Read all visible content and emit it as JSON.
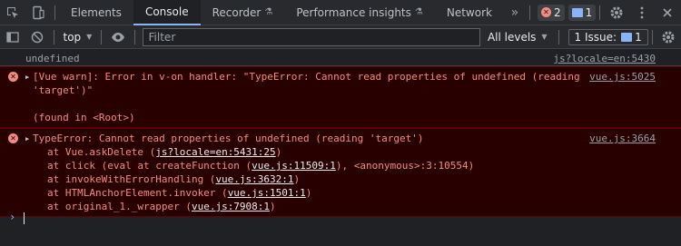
{
  "tabs": [
    {
      "label": "Elements"
    },
    {
      "label": "Console"
    },
    {
      "label": "Recorder"
    },
    {
      "label": "Performance insights"
    },
    {
      "label": "Network"
    }
  ],
  "tab_more": "»",
  "counts": {
    "errors": "2",
    "messages": "1"
  },
  "toolbar": {
    "context": "top",
    "filter_placeholder": "Filter",
    "levels": "All levels",
    "issues_label": "1 Issue:",
    "issues_count": "1"
  },
  "console": {
    "plain": {
      "text": "undefined",
      "source": "js?locale=en:5430"
    },
    "warn": {
      "line1": "[Vue warn]: Error in v-on handler: \"TypeError: Cannot read properties of undefined (reading 'target')\"",
      "line2": "(found in <Root>)",
      "source": "vue.js:5025"
    },
    "error": {
      "headline": "TypeError: Cannot read properties of undefined (reading 'target')",
      "source": "vue.js:3664",
      "frames": [
        {
          "prefix": "at Vue.askDelete (",
          "link": "js?locale=en:5431:25",
          "suffix": ")"
        },
        {
          "prefix": "at click (eval at createFunction (",
          "link": "vue.js:11509:1",
          "suffix": "), <anonymous>:3:10554)"
        },
        {
          "prefix": "at invokeWithErrorHandling (",
          "link": "vue.js:3632:1",
          "suffix": ")"
        },
        {
          "prefix": "at HTMLAnchorElement.invoker (",
          "link": "vue.js:1501:1",
          "suffix": ")"
        },
        {
          "prefix": "at original_1._wrapper (",
          "link": "vue.js:7908:1",
          "suffix": ")"
        }
      ]
    }
  },
  "colors": {
    "accent": "#8ab4f8",
    "error": "#f28b82",
    "error_bg": "#290000"
  }
}
